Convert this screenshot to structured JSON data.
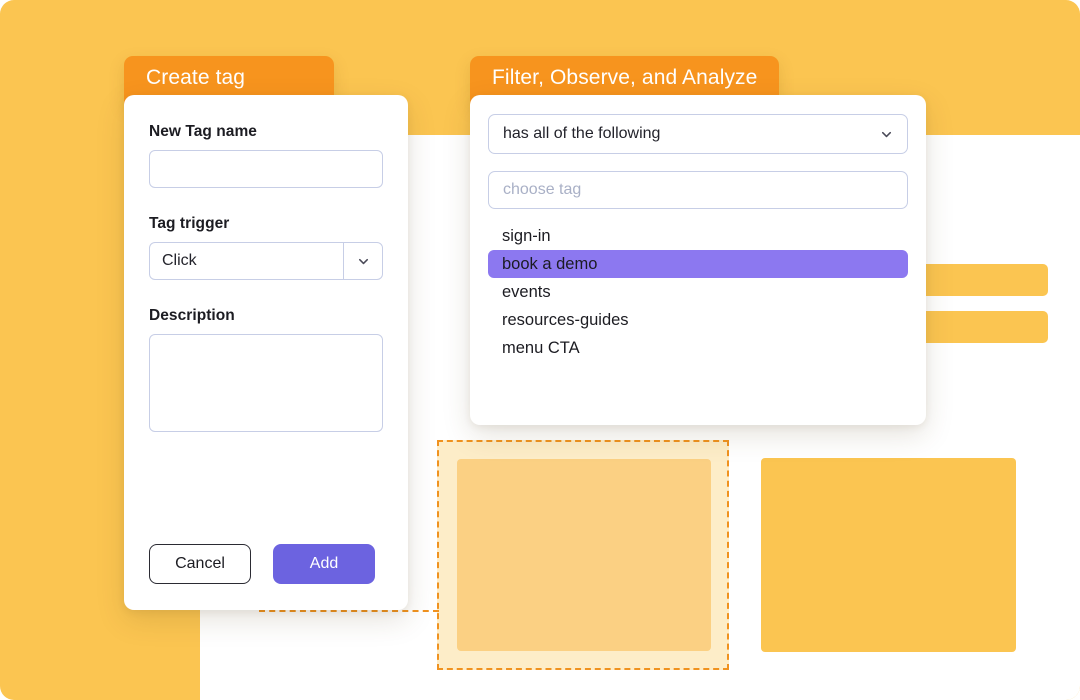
{
  "background": {
    "plate_color": "#FBC551",
    "canvas_color": "#FFFFFF",
    "selection_border_color": "#F0921F",
    "selection_fill_color": "#FDEDC8",
    "selection_inner_color": "#FBD083",
    "connector_dot_color": "#F5A33C"
  },
  "create_tag_dialog": {
    "title": "Create tag",
    "header_color": "#F7941E",
    "fields": {
      "name_label": "New Tag name",
      "name_value": "",
      "name_placeholder": "",
      "trigger_label": "Tag trigger",
      "trigger_value": "Click",
      "description_label": "Description",
      "description_value": "",
      "description_placeholder": ""
    },
    "buttons": {
      "cancel_label": "Cancel",
      "add_label": "Add",
      "add_color": "#6C63E0"
    },
    "icons": {
      "trigger_chevron": "chevron-down-icon"
    }
  },
  "filter_dialog": {
    "title": "Filter, Observe, and Analyze",
    "header_color": "#F7941E",
    "condition_select": {
      "value": "has all of the following",
      "chevron": "chevron-down-icon"
    },
    "tag_search": {
      "value": "",
      "placeholder": "choose tag"
    },
    "tag_options": [
      {
        "label": "sign-in",
        "selected": false
      },
      {
        "label": "book a demo",
        "selected": true
      },
      {
        "label": "events",
        "selected": false
      },
      {
        "label": "resources-guides",
        "selected": false
      },
      {
        "label": "menu CTA",
        "selected": false
      }
    ],
    "selected_color": "#8C78F0"
  }
}
